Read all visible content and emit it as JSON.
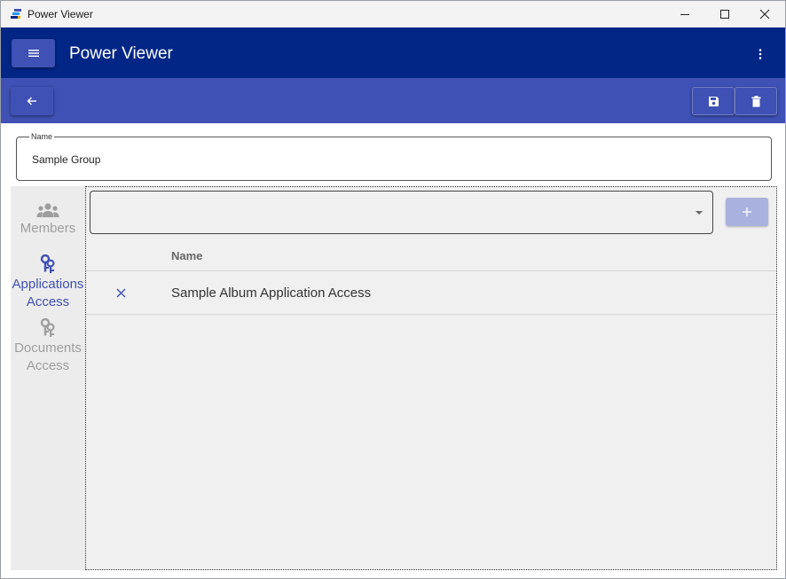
{
  "window": {
    "title": "Power Viewer"
  },
  "appbar": {
    "title": "Power Viewer",
    "menu_icon": "hamburger-icon",
    "more_icon": "more-vertical-icon",
    "color": "#022686"
  },
  "toolbar": {
    "back_icon": "arrow-left-icon",
    "save_icon": "save-icon",
    "delete_icon": "trash-icon",
    "color": "#3f51b5"
  },
  "name_field": {
    "label": "Name",
    "value": "Sample Group"
  },
  "sidebar": {
    "items": [
      {
        "line1": "Members",
        "line2": "",
        "icon": "group-icon",
        "active": false
      },
      {
        "line1": "Applications",
        "line2": "Access",
        "icon": "keys-icon",
        "active": true
      },
      {
        "line1": "Documents",
        "line2": "Access",
        "icon": "keys-icon",
        "active": false
      }
    ],
    "active_color": "#3f51b5",
    "inactive_color": "#9e9e9e"
  },
  "content": {
    "select_value": "",
    "add_icon": "plus-icon",
    "table": {
      "headers": [
        "",
        "Name"
      ],
      "rows": [
        {
          "remove_icon": "close-icon",
          "name": "Sample Album Application Access"
        }
      ]
    }
  }
}
